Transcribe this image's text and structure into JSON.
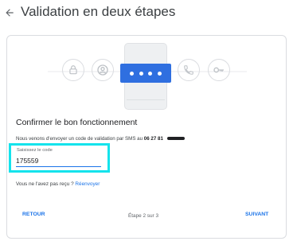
{
  "header": {
    "title": "Validation en deux étapes",
    "back_icon": "arrow-back-icon"
  },
  "illustration": {
    "icons": [
      "lock-icon",
      "account-circle-icon",
      "phone-icon",
      "key-icon"
    ],
    "code_dots": 4,
    "accent_color": "#2f6fe0"
  },
  "confirm": {
    "heading": "Confirmer le bon fonctionnement",
    "sms_prefix": "Nous venons d'envoyer un code de validation par SMS au",
    "phone_number": "06 27 81"
  },
  "code_field": {
    "label": "Saisissez le code",
    "value": "175559",
    "highlight_color": "#14e3ec"
  },
  "resend": {
    "prompt": "Vous ne l'avez pas reçu ?",
    "link": "Réenvoyer"
  },
  "footer": {
    "back_label": "RETOUR",
    "step_text": "Étape 2 sur 3",
    "next_label": "SUIVANT"
  }
}
